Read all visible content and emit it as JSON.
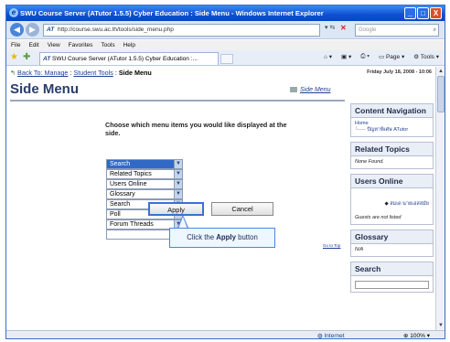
{
  "window": {
    "title": "SWU Course Server (ATutor 1.5.5) Cyber Education : Side Menu - Windows Internet Explorer",
    "buttons": [
      "_",
      "□",
      "X"
    ]
  },
  "browser": {
    "address": "http://course.swu.ac.th/tools/side_menu.php",
    "search_placeholder": "Google",
    "menu": [
      "File",
      "Edit",
      "View",
      "Favorites",
      "Tools",
      "Help"
    ],
    "tab_label": "SWU Course Server (ATutor 1.5.5) Cyber Education :...",
    "toolbar": {
      "page": "Page",
      "tools": "Tools"
    }
  },
  "page": {
    "breadcrumb": {
      "back": "Back To: Manage",
      "sep1": " : ",
      "tools": "Student Tools",
      "sep2": " : ",
      "current": "Side Menu"
    },
    "date": "Friday July 18, 2008 - 10:06",
    "title": "Side Menu",
    "side_menu_link": "Side Menu",
    "prompt": "Choose which menu items you would like displayed at the side.",
    "menu_items": [
      "Search",
      "Related Topics",
      "Users Online",
      "Glossary",
      "Search",
      "Poll",
      "Forum Threads",
      ""
    ],
    "apply_label": "Apply",
    "cancel_label": "Cancel",
    "callout_prefix": "Click the ",
    "callout_bold": "Apply",
    "callout_suffix": " button",
    "goto_top": "Go to Top"
  },
  "sidebar": {
    "content_navigation": {
      "title": "Content Navigation",
      "home": "Home",
      "item": "ปัญหาพิเศษ ATutor"
    },
    "related_topics": {
      "title": "Related Topics",
      "body": "None Found."
    },
    "users_online": {
      "title": "Users Online",
      "user": "สมเด นายเอสสมัย",
      "note": "Guests are not listed"
    },
    "glossary": {
      "title": "Glossary",
      "body": "N/A"
    },
    "search": {
      "title": "Search"
    }
  },
  "status": {
    "zone": "Internet",
    "zoom": "100%"
  },
  "colors": {
    "titlebar": "#0f4fd1",
    "selected": "#3169c6",
    "accent": "#2b3d6b"
  }
}
